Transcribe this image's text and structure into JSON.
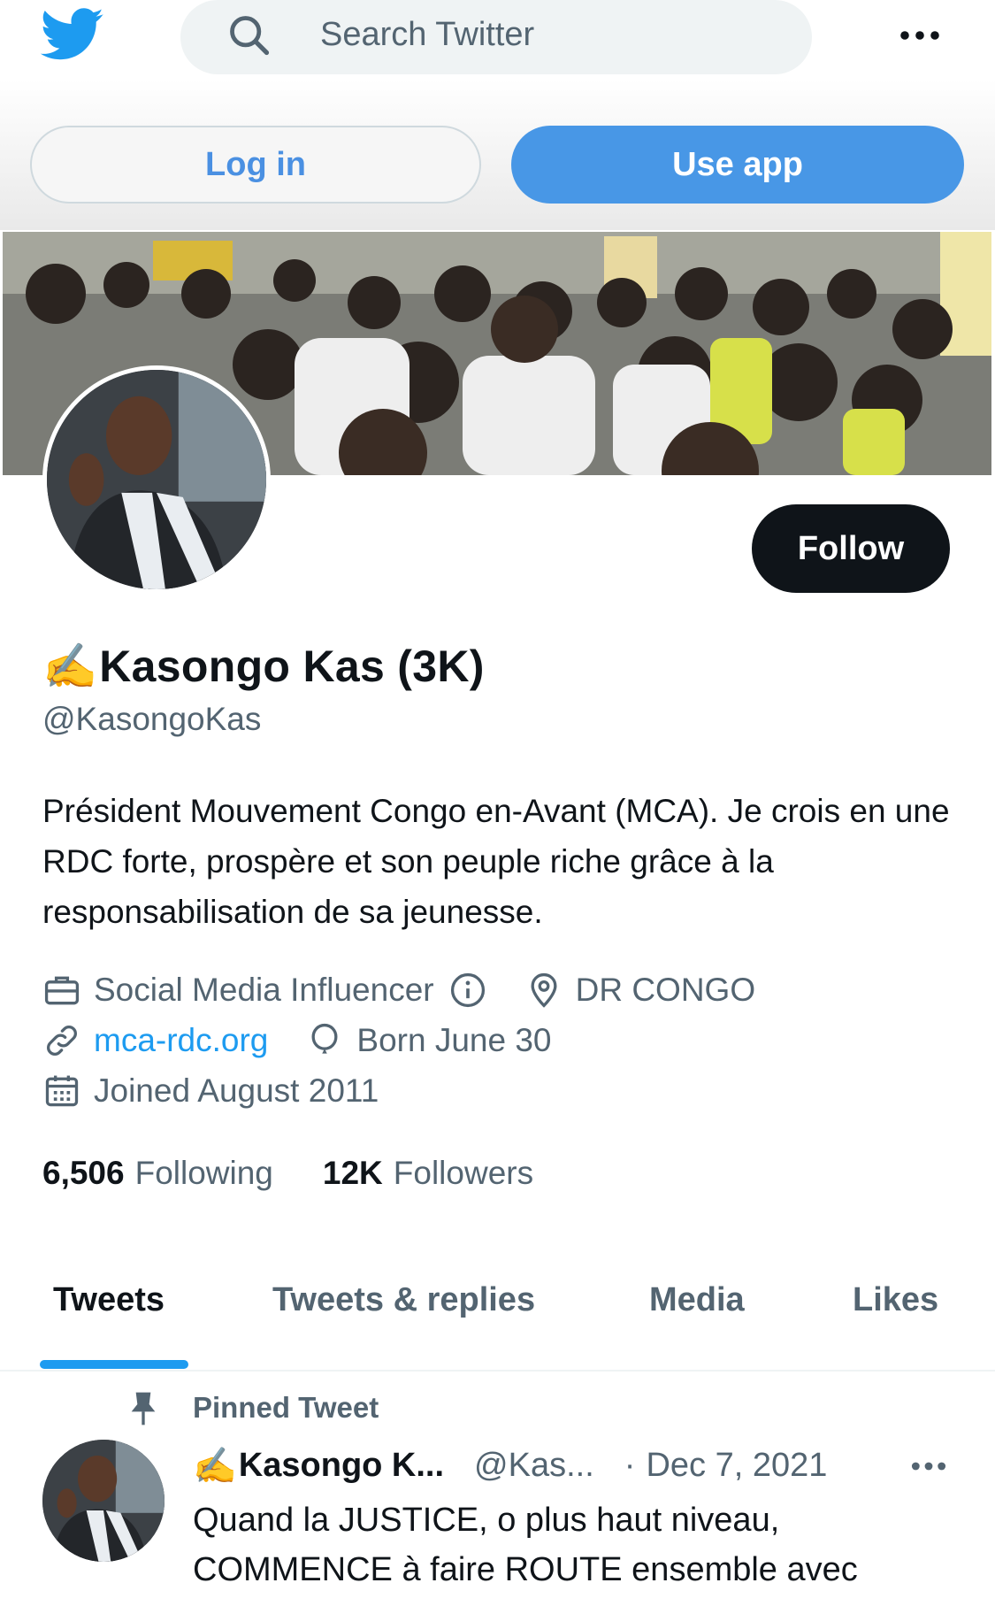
{
  "topbar": {
    "logo_icon": "twitter-bird-icon",
    "search_placeholder": "Search Twitter",
    "more_icon": "more-horizontal-icon"
  },
  "auth": {
    "login_label": "Log in",
    "useapp_label": "Use app"
  },
  "profile": {
    "follow_label": "Follow",
    "name_emoji": "✍️",
    "name": "Kasongo Kas (3K)",
    "handle": "@KasongoKas",
    "bio": "Président Mouvement Congo en-Avant (MCA). Je crois en une RDC forte, prospère et son peuple riche grâce à la responsabilisation de sa jeunesse.",
    "category": "Social Media Influencer",
    "location": "DR CONGO",
    "website": "mca-rdc.org",
    "birthday": "Born June 30",
    "joined": "Joined August 2011",
    "following_count": "6,506",
    "following_label": "Following",
    "followers_count": "12K",
    "followers_label": "Followers"
  },
  "tabs": [
    {
      "label": "Tweets",
      "active": true
    },
    {
      "label": "Tweets & replies",
      "active": false
    },
    {
      "label": "Media",
      "active": false
    },
    {
      "label": "Likes",
      "active": false
    }
  ],
  "pinned_tweet": {
    "label": "Pinned Tweet",
    "author_emoji": "✍️",
    "author_name": "Kasongo K...",
    "author_handle": "@Kas...",
    "separator": "·",
    "date": "Dec 7, 2021",
    "text": "Quand la JUSTICE, o plus haut niveau, COMMENCE à faire ROUTE ensemble avec"
  },
  "colors": {
    "accent": "#1d9bf0",
    "useapp_bg": "#4897e6",
    "follow_bg": "#0f1419",
    "secondary_text": "#536471"
  }
}
